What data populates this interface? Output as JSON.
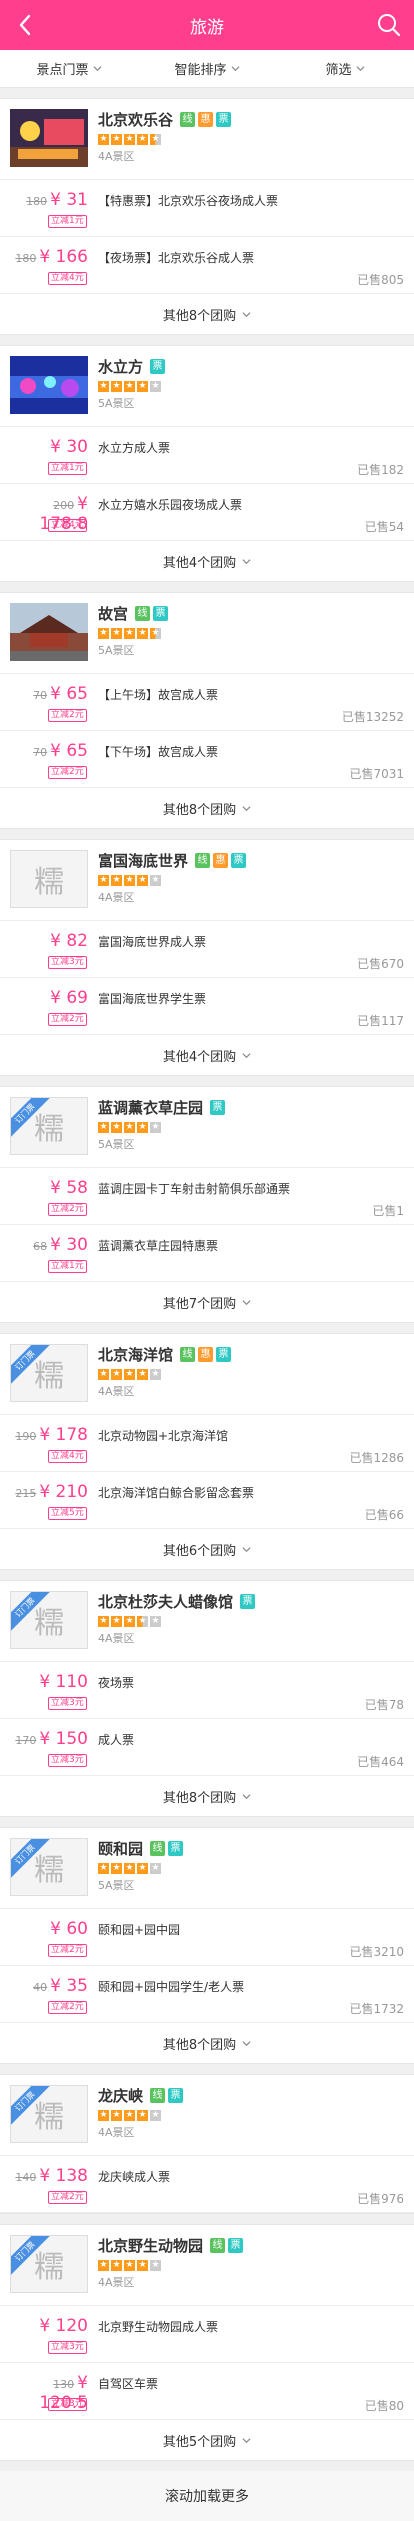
{
  "header": {
    "title": "旅游",
    "back_icon": "chevron-left-icon",
    "search_icon": "search-icon"
  },
  "filters": [
    {
      "label": "景点门票"
    },
    {
      "label": "智能排序"
    },
    {
      "label": "筛选"
    }
  ],
  "theme": {
    "accent": "#ff3f8e",
    "star": "#ff9b1a",
    "tag_green": "#5ac35f",
    "tag_orange": "#ff9a2e",
    "tag_teal": "#2ec9c4"
  },
  "venues": [
    {
      "name": "北京欢乐谷",
      "tags": [
        "线",
        "惠",
        "票"
      ],
      "level": "4A景区",
      "stars": 4.5,
      "has_photo": true,
      "ribbon": "",
      "deals": [
        {
          "orig": "180",
          "price": "¥ 31",
          "cut": "立减1元",
          "title": "【特惠票】北京欢乐谷夜场成人票",
          "sold": ""
        },
        {
          "orig": "180",
          "price": "¥ 166",
          "cut": "立减4元",
          "title": "【夜场票】北京欢乐谷成人票",
          "sold": "已售805"
        }
      ],
      "more": "其他8个团购"
    },
    {
      "name": "水立方",
      "tags": [
        "票"
      ],
      "level": "5A景区",
      "stars": 4,
      "has_photo": true,
      "ribbon": "",
      "deals": [
        {
          "orig": "",
          "price": "¥ 30",
          "cut": "立减1元",
          "title": "水立方成人票",
          "sold": "已售182"
        },
        {
          "orig": "200",
          "price": "¥ 178.8",
          "cut": "立减4元",
          "title": "水立方嬉水乐园夜场成人票",
          "sold": "已售54"
        }
      ],
      "more": "其他4个团购"
    },
    {
      "name": "故宫",
      "tags": [
        "线",
        "票"
      ],
      "level": "5A景区",
      "stars": 4.5,
      "has_photo": true,
      "ribbon": "",
      "deals": [
        {
          "orig": "70",
          "price": "¥ 65",
          "cut": "立减2元",
          "title": "【上午场】故宫成人票",
          "sold": "已售13252"
        },
        {
          "orig": "70",
          "price": "¥ 65",
          "cut": "立减2元",
          "title": "【下午场】故宫成人票",
          "sold": "已售7031"
        }
      ],
      "more": "其他8个团购"
    },
    {
      "name": "富国海底世界",
      "tags": [
        "线",
        "惠",
        "票"
      ],
      "level": "4A景区",
      "stars": 4,
      "has_photo": false,
      "ribbon": "",
      "deals": [
        {
          "orig": "",
          "price": "¥ 82",
          "cut": "立减3元",
          "title": "富国海底世界成人票",
          "sold": "已售670"
        },
        {
          "orig": "",
          "price": "¥ 69",
          "cut": "立减2元",
          "title": "富国海底世界学生票",
          "sold": "已售117"
        }
      ],
      "more": "其他4个团购"
    },
    {
      "name": "蓝调薰衣草庄园",
      "tags": [
        "票"
      ],
      "level": "5A景区",
      "stars": 4,
      "has_photo": false,
      "ribbon": "订门票",
      "deals": [
        {
          "orig": "",
          "price": "¥ 58",
          "cut": "立减2元",
          "title": "蓝调庄园卡丁车射击射箭俱乐部通票",
          "sold": "已售1"
        },
        {
          "orig": "68",
          "price": "¥ 30",
          "cut": "立减1元",
          "title": "蓝调薰衣草庄园特惠票",
          "sold": ""
        }
      ],
      "more": "其他7个团购"
    },
    {
      "name": "北京海洋馆",
      "tags": [
        "线",
        "惠",
        "票"
      ],
      "level": "4A景区",
      "stars": 4,
      "has_photo": false,
      "ribbon": "订门票",
      "deals": [
        {
          "orig": "190",
          "price": "¥ 178",
          "cut": "立减4元",
          "title": "北京动物园+北京海洋馆",
          "sold": "已售1286"
        },
        {
          "orig": "215",
          "price": "¥ 210",
          "cut": "立减5元",
          "title": "北京海洋馆白鲸合影留念套票",
          "sold": "已售66"
        }
      ],
      "more": "其他6个团购"
    },
    {
      "name": "北京杜莎夫人蜡像馆",
      "tags": [
        "票"
      ],
      "level": "4A景区",
      "stars": 3.5,
      "has_photo": false,
      "ribbon": "订门票",
      "deals": [
        {
          "orig": "",
          "price": "¥ 110",
          "cut": "立减3元",
          "title": "夜场票",
          "sold": "已售78"
        },
        {
          "orig": "170",
          "price": "¥ 150",
          "cut": "立减3元",
          "title": "成人票",
          "sold": "已售464"
        }
      ],
      "more": "其他8个团购"
    },
    {
      "name": "颐和园",
      "tags": [
        "线",
        "票"
      ],
      "level": "5A景区",
      "stars": 4,
      "has_photo": false,
      "ribbon": "订门票",
      "deals": [
        {
          "orig": "",
          "price": "¥ 60",
          "cut": "立减2元",
          "title": "颐和园+园中园",
          "sold": "已售3210"
        },
        {
          "orig": "40",
          "price": "¥ 35",
          "cut": "立减2元",
          "title": "颐和园+园中园学生/老人票",
          "sold": "已售1732"
        }
      ],
      "more": "其他8个团购"
    },
    {
      "name": "龙庆峡",
      "tags": [
        "线",
        "票"
      ],
      "level": "4A景区",
      "stars": 4,
      "has_photo": false,
      "ribbon": "订门票",
      "deals": [
        {
          "orig": "140",
          "price": "¥ 138",
          "cut": "立减2元",
          "title": "龙庆峡成人票",
          "sold": "已售976"
        }
      ],
      "more": ""
    },
    {
      "name": "北京野生动物园",
      "tags": [
        "线",
        "票"
      ],
      "level": "4A景区",
      "stars": 4,
      "has_photo": false,
      "ribbon": "订门票",
      "deals": [
        {
          "orig": "",
          "price": "¥ 120",
          "cut": "立减3元",
          "title": "北京野生动物园成人票",
          "sold": ""
        },
        {
          "orig": "130",
          "price": "¥ 120.5",
          "cut": "立减3元",
          "title": "自驾区车票",
          "sold": "已售80"
        }
      ],
      "more": "其他5个团购"
    }
  ],
  "placeholder_glyph": "糯",
  "load_more": "滚动加载更多"
}
